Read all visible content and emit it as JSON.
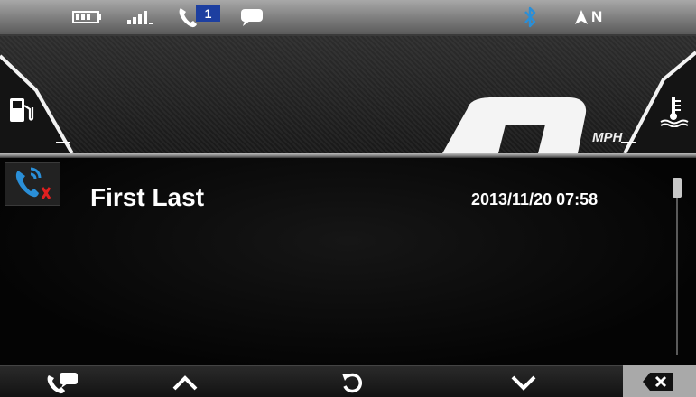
{
  "status_bar": {
    "icons": [
      "battery-icon",
      "signal-icon",
      "missed-call-icon",
      "message-icon",
      "bluetooth-icon",
      "compass-arrow-icon"
    ],
    "missed_calls": "1",
    "heading": "N"
  },
  "gauges": {
    "speed_unit": "MPH",
    "icons": [
      "fuel-icon",
      "coolant-temperature-icon"
    ]
  },
  "call_log": {
    "entry": {
      "icon": "missed-call-icon",
      "name": "First Last",
      "time": "2013/11/20 07:58"
    }
  },
  "bottom_bar": {
    "buttons": [
      "call-message-button",
      "scroll-up-button",
      "refresh-button",
      "scroll-down-button",
      "delete-button"
    ]
  },
  "colors": {
    "accent_blue": "#2a8fd8",
    "missed_red": "#e02020",
    "badge_blue": "#1d3fa0"
  }
}
